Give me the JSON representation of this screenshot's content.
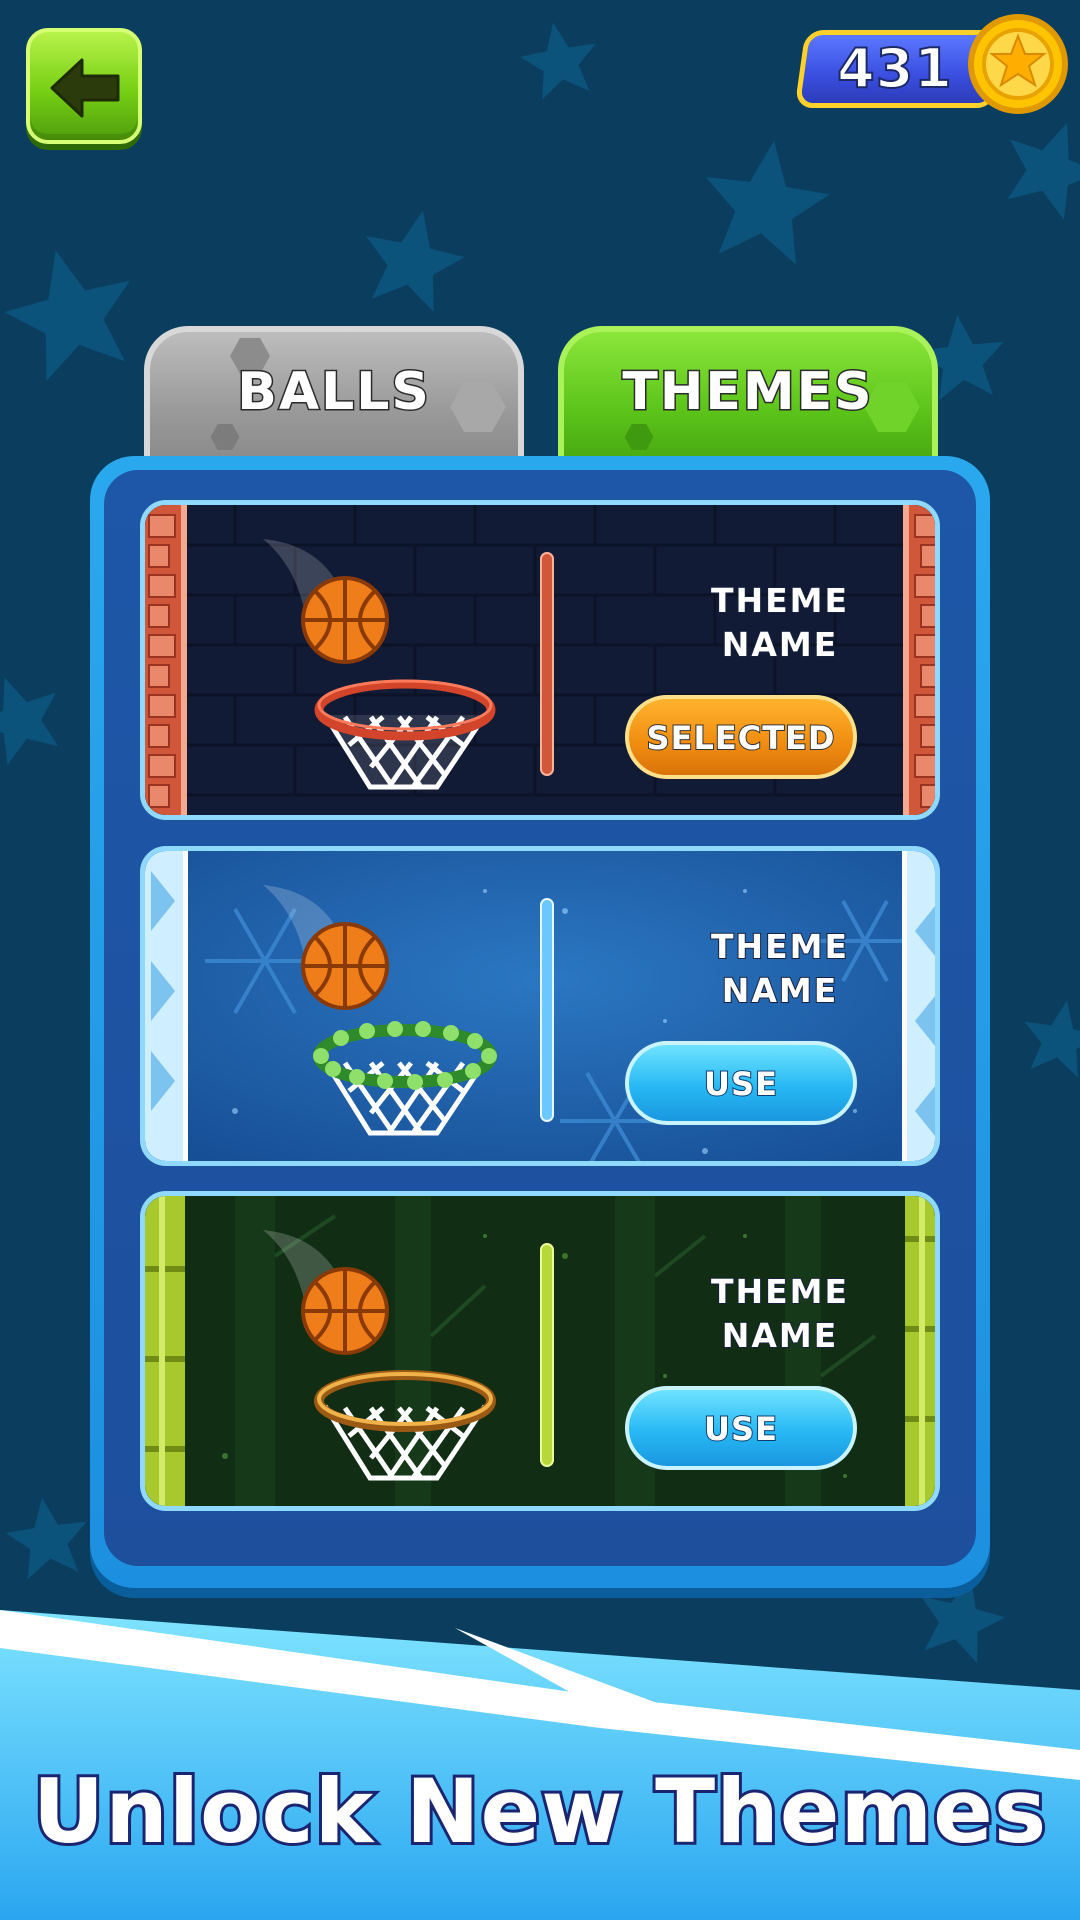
{
  "coins": {
    "count": "431"
  },
  "tabs": [
    {
      "label": "BALLS",
      "active": false
    },
    {
      "label": "THEMES",
      "active": true
    }
  ],
  "themes": [
    {
      "title": "THEME\nNAME",
      "button": "SELECTED",
      "state": "selected",
      "style": "brick"
    },
    {
      "title": "THEME\nNAME",
      "button": "USE",
      "state": "available",
      "style": "ice"
    },
    {
      "title": "THEME\nNAME",
      "button": "USE",
      "state": "available",
      "style": "bamboo"
    }
  ],
  "banner": {
    "headline": "Unlock New Themes"
  },
  "colors": {
    "background": "#0b3e5e",
    "tab_active": "#5cc41a",
    "tab_inactive": "#9a9a9a",
    "selected_button": "#f08c10",
    "use_button": "#27b8f4",
    "coin": "#ffc400"
  }
}
